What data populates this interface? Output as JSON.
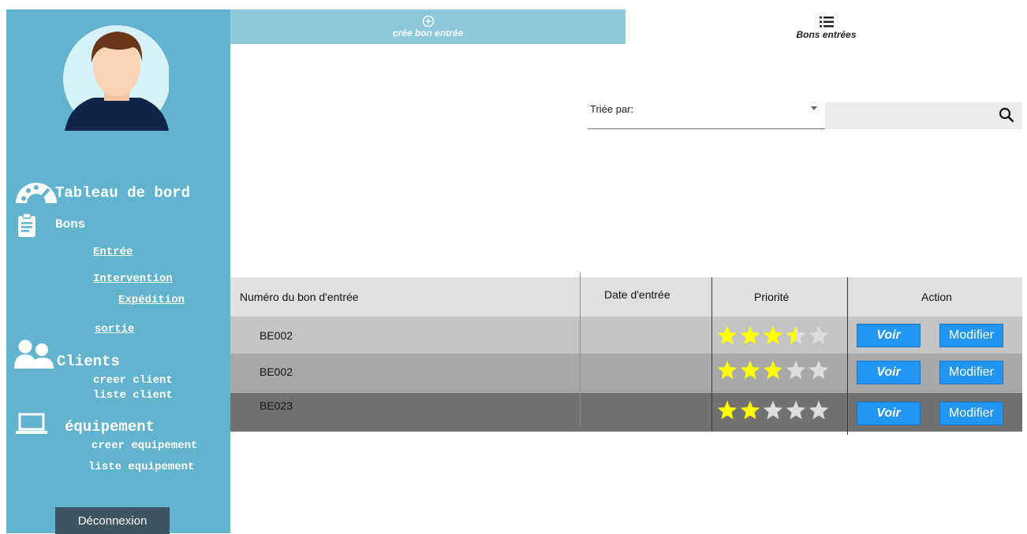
{
  "tabs": {
    "create_label": "crée bon entrée",
    "list_label": "Bons entrées"
  },
  "sidebar": {
    "dashboard": "Tableau de bord",
    "bons": "Bons",
    "bons_items": [
      "Entrée",
      "Intervention",
      "Expédition",
      "sortie"
    ],
    "clients": "Clients",
    "clients_items": [
      "creer client",
      "liste client"
    ],
    "equipement": "équipement",
    "equipement_items": [
      "creer equipement",
      "liste equipement"
    ],
    "logout": "Déconnexion"
  },
  "filters": {
    "sort_label": "Triée par:"
  },
  "table": {
    "headers": [
      "Numéro du bon d'entrée",
      "Date d'entrée",
      "Priorité",
      "Action"
    ],
    "rows": [
      {
        "numero": "BE002",
        "date": "",
        "priority": 3.5
      },
      {
        "numero": "BE002",
        "date": "",
        "priority": 3
      },
      {
        "numero": "BE023",
        "date": "",
        "priority": 2
      }
    ],
    "voir_label": "Voir",
    "modifier_label": "Modifier"
  },
  "colors": {
    "sidebar": "#62b3cd",
    "tab_active": "#8ec8dc",
    "button": "#2196f3",
    "star_filled": "#ffff00",
    "star_empty": "#dddddd"
  },
  "icons": [
    "plus-circle-icon",
    "list-icon",
    "dashboard-gauge-icon",
    "clipboard-icon",
    "users-icon",
    "laptop-icon",
    "search-icon",
    "star-icon"
  ]
}
